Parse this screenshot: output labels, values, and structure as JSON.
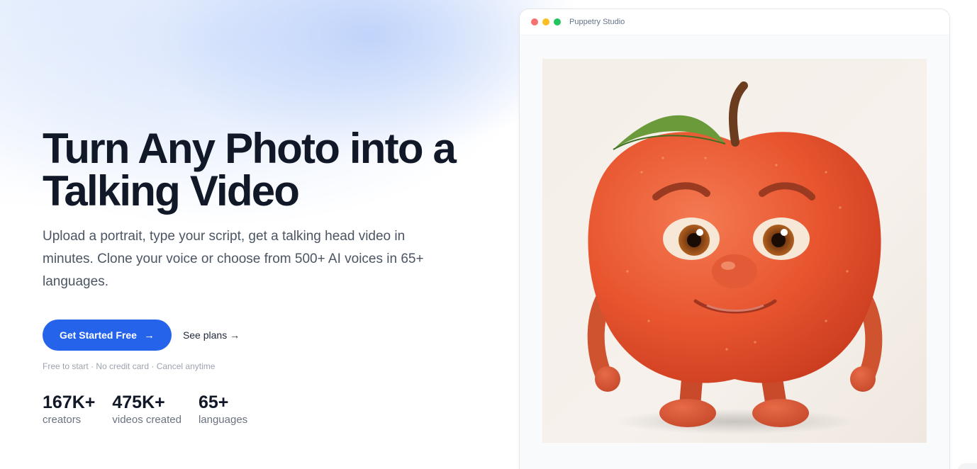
{
  "hero": {
    "title_line1": "Turn Any Photo into a",
    "title_line2": "Talking Video",
    "subtitle": "Upload a portrait, type your script, get a talking head video in minutes. Clone your voice or choose from 500+ AI voices in 65+ languages.",
    "primary_cta": "Get Started Free",
    "primary_cta_arrow": "→",
    "secondary_cta": "See plans →",
    "fineprint": "Free to start · No credit card · Cancel anytime"
  },
  "stats": [
    {
      "value": "167K+",
      "label": "creators"
    },
    {
      "value": "475K+",
      "label": "videos created"
    },
    {
      "value": "65+",
      "label": "languages"
    }
  ],
  "preview_window": {
    "title": "Puppetry Studio",
    "dots": [
      "#f87171",
      "#fbbf24",
      "#22c55e"
    ],
    "image_subject": "cartoon apple character with face"
  },
  "colors": {
    "accent": "#2563eb",
    "heading": "#111827",
    "body_text": "#4b5563",
    "muted": "#9ca3af"
  }
}
